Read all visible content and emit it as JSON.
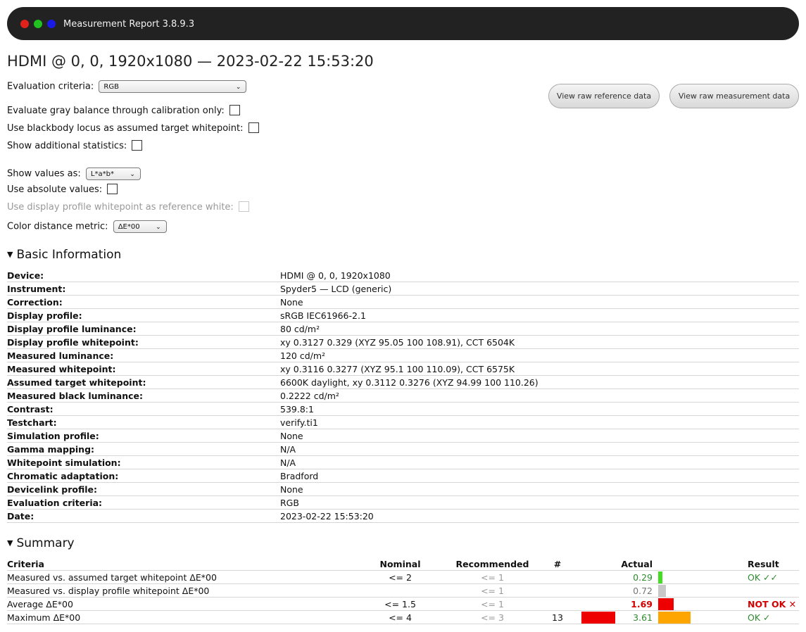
{
  "window": {
    "title": "Measurement Report 3.8.9.3",
    "colors": {
      "close": "#e0221a",
      "minimize": "#20c020",
      "maximize": "#1a1ae6",
      "titlebar": "#222222"
    }
  },
  "heading": "HDMI @ 0, 0, 1920x1080 — 2023-02-22 15:53:20",
  "options": {
    "evaluation_criteria_label": "Evaluation criteria:",
    "evaluation_criteria_value": "RGB",
    "gray_balance_label": "Evaluate gray balance through calibration only:",
    "gray_balance_checked": false,
    "blackbody_label": "Use blackbody locus as assumed target whitepoint:",
    "blackbody_checked": false,
    "additional_stats_label": "Show additional statistics:",
    "additional_stats_checked": false,
    "show_values_label": "Show values as:",
    "show_values_value": "L*a*b*",
    "absolute_label": "Use absolute values:",
    "absolute_checked": false,
    "profile_whitepoint_label": "Use display profile whitepoint as reference white:",
    "profile_whitepoint_disabled": true,
    "distance_metric_label": "Color distance metric:",
    "distance_metric_value": "ΔE*00"
  },
  "buttons": {
    "raw_reference": "View raw reference data",
    "raw_measurement": "View raw measurement data"
  },
  "basic_info": {
    "title": "Basic Information",
    "rows": [
      {
        "key": "Device:",
        "value": "HDMI @ 0, 0, 1920x1080"
      },
      {
        "key": "Instrument:",
        "value": "Spyder5 — LCD (generic)"
      },
      {
        "key": "Correction:",
        "value": "None"
      },
      {
        "key": "Display profile:",
        "value": "sRGB IEC61966-2.1"
      },
      {
        "key": "Display profile luminance:",
        "value": "80 cd/m²"
      },
      {
        "key": "Display profile whitepoint:",
        "value": "xy 0.3127 0.329 (XYZ 95.05 100 108.91), CCT 6504K"
      },
      {
        "key": "Measured luminance:",
        "value": "120 cd/m²"
      },
      {
        "key": "Measured whitepoint:",
        "value": "xy 0.3116 0.3277 (XYZ 95.1 100 110.09), CCT 6575K"
      },
      {
        "key": "Assumed target whitepoint:",
        "value": "6600K daylight, xy 0.3112 0.3276 (XYZ 94.99 100 110.26)"
      },
      {
        "key": "Measured black luminance:",
        "value": "0.2222 cd/m²"
      },
      {
        "key": "Contrast:",
        "value": "539.8:1"
      },
      {
        "key": "Testchart:",
        "value": "verify.ti1"
      },
      {
        "key": "Simulation profile:",
        "value": "None"
      },
      {
        "key": "Gamma mapping:",
        "value": "N/A"
      },
      {
        "key": "Whitepoint simulation:",
        "value": "N/A"
      },
      {
        "key": "Chromatic adaptation:",
        "value": "Bradford"
      },
      {
        "key": "Devicelink profile:",
        "value": "None"
      },
      {
        "key": "Evaluation criteria:",
        "value": "RGB"
      },
      {
        "key": "Date:",
        "value": "2023-02-22 15:53:20"
      }
    ]
  },
  "summary": {
    "title": "Summary",
    "headers": {
      "criteria": "Criteria",
      "nominal": "Nominal",
      "recommended": "Recommended",
      "count": "#",
      "actual": "Actual",
      "result": "Result"
    },
    "rows": [
      {
        "criteria": "Measured vs. assumed target whitepoint ΔE*00",
        "nominal": "<= 2",
        "recommended": "<= 1",
        "count": "",
        "count_bar_color": "",
        "actual": "0.29",
        "actual_class": "act-green",
        "actual_bar_fraction": 0.13,
        "actual_bar_color": "#44dd22",
        "result": "OK ✓✓",
        "result_class": "res-ok"
      },
      {
        "criteria": "Measured vs. display profile whitepoint ΔE*00",
        "nominal": "",
        "recommended": "<= 1",
        "count": "",
        "count_bar_color": "",
        "actual": "0.72",
        "actual_class": "act-gray",
        "actual_bar_fraction": 0.24,
        "actual_bar_color": "#c8c8c8",
        "result": "",
        "result_class": ""
      },
      {
        "criteria": "Average ΔE*00",
        "nominal": "<= 1.5",
        "recommended": "<= 1",
        "count": "",
        "count_bar_color": "",
        "actual": "1.69",
        "actual_class": "act-red",
        "actual_bar_fraction": 0.47,
        "actual_bar_color": "#ee0000",
        "result": "NOT OK ✕",
        "result_class": "res-bad"
      },
      {
        "criteria": "Maximum ΔE*00",
        "nominal": "<= 4",
        "recommended": "<= 3",
        "count": "13",
        "count_bar_color": "#ee0000",
        "actual": "3.61",
        "actual_class": "act-green",
        "actual_bar_fraction": 1.0,
        "actual_bar_color": "#ffa500",
        "result": "OK ✓",
        "result_class": "res-ok"
      }
    ]
  }
}
